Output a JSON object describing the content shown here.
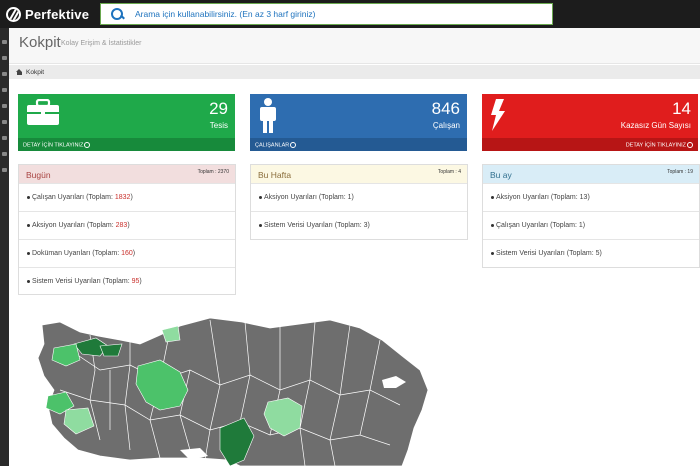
{
  "topbar": {
    "brand": "Perfektive",
    "search_placeholder": "Arama için kullanabilirsiniz. (En az 3 harf giriniz)"
  },
  "header": {
    "title": "Kokpit",
    "subtitle": "Kolay Erişim & İstatistikler"
  },
  "breadcrumb": {
    "label": "Kokpit"
  },
  "stats": [
    {
      "value": "29",
      "label": "Tesis",
      "footer": "DETAY İÇİN TIKLAYINIZ",
      "color": "#1fa94a"
    },
    {
      "value": "846",
      "label": "Çalışan",
      "footer": "ÇALIŞANLAR",
      "color": "#2e6db0"
    },
    {
      "value": "14",
      "label": "Kazasız Gün Sayısı",
      "footer": "DETAY İÇİN TIKLAYINIZ",
      "color": "#e01d1d"
    }
  ],
  "panels": {
    "bugun": {
      "title": "Bugün",
      "total": "Toplam : 2370",
      "rows": [
        {
          "label": "Çalışan Uyarıları (Toplam: ",
          "count": "1832",
          "end": ")"
        },
        {
          "label": "Aksiyon Uyarıları (Toplam: ",
          "count": "283",
          "end": ")"
        },
        {
          "label": "Doküman Uyarıları (Toplam: ",
          "count": "160",
          "end": ")"
        },
        {
          "label": "Sistem Verisi Uyarıları (Toplam: ",
          "count": "95",
          "end": ")"
        }
      ]
    },
    "hafta": {
      "title": "Bu Hafta",
      "total": "Toplam : 4",
      "rows": [
        {
          "label": "Aksiyon Uyarıları (Toplam: ",
          "count": "1",
          "end": ")"
        },
        {
          "label": "Sistem Verisi Uyarıları (Toplam: ",
          "count": "3",
          "end": ")"
        }
      ]
    },
    "ay": {
      "title": "Bu ay",
      "total": "Toplam : 19",
      "rows": [
        {
          "label": "Aksiyon Uyarıları (Toplam: ",
          "count": "13",
          "end": ")"
        },
        {
          "label": "Çalışan Uyarıları (Toplam: ",
          "count": "1",
          "end": ")"
        },
        {
          "label": "Sistem Verisi Uyarıları (Toplam: ",
          "count": "5",
          "end": ")"
        }
      ]
    }
  },
  "map": {
    "icon": "turkey-province-map",
    "base_color": "#6e6e6e",
    "highlight_colors": [
      "#1f7a3a",
      "#4cc26a",
      "#8fdca0"
    ]
  }
}
